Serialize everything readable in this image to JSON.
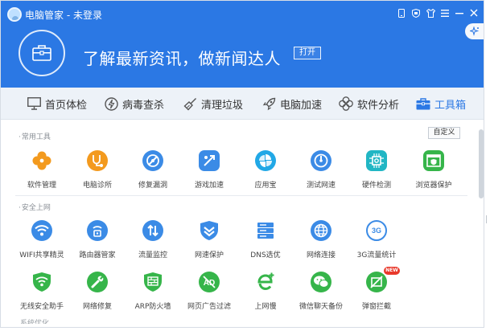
{
  "app": {
    "title": "电脑管家 - 未登录"
  },
  "banner": {
    "text": "了解最新资讯，做新闻达人",
    "open_label": "打开"
  },
  "nav": [
    {
      "key": "home",
      "label": "首页体检"
    },
    {
      "key": "virus",
      "label": "病毒查杀"
    },
    {
      "key": "clean",
      "label": "清理垃圾"
    },
    {
      "key": "speed",
      "label": "电脑加速"
    },
    {
      "key": "software",
      "label": "软件分析"
    },
    {
      "key": "toolbox",
      "label": "工具箱",
      "active": true
    }
  ],
  "sections": [
    {
      "title": "常用工具",
      "custom_label": "自定义",
      "tools": [
        "软件管理",
        "电脑诊所",
        "修复漏洞",
        "游戏加速",
        "应用宝",
        "测试网速",
        "硬件检测",
        "浏览器保护"
      ]
    },
    {
      "title": "安全上网",
      "tools_row1": [
        "WIFI共享精灵",
        "路由器管家",
        "流量监控",
        "网速保护",
        "DNS选优",
        "网络连接",
        "3G流量统计"
      ],
      "tools_row2": [
        "无线安全助手",
        "网络修复",
        "ARP防火墙",
        "网页广告过滤",
        "上网慢",
        "微信聊天备份",
        "弹窗拦截"
      ]
    }
  ],
  "badges": {
    "new": "NEW",
    "three_g": "3G"
  },
  "bottom_section_partial": "系统优化",
  "colors": {
    "brand_blue": "#2b78e4",
    "nav_bg": "#edf2f8",
    "orange": "#f39a1e",
    "blue_icon": "#3b8be6",
    "green": "#36b54a",
    "teal": "#21b6c4",
    "badge_red": "#e8392b"
  }
}
